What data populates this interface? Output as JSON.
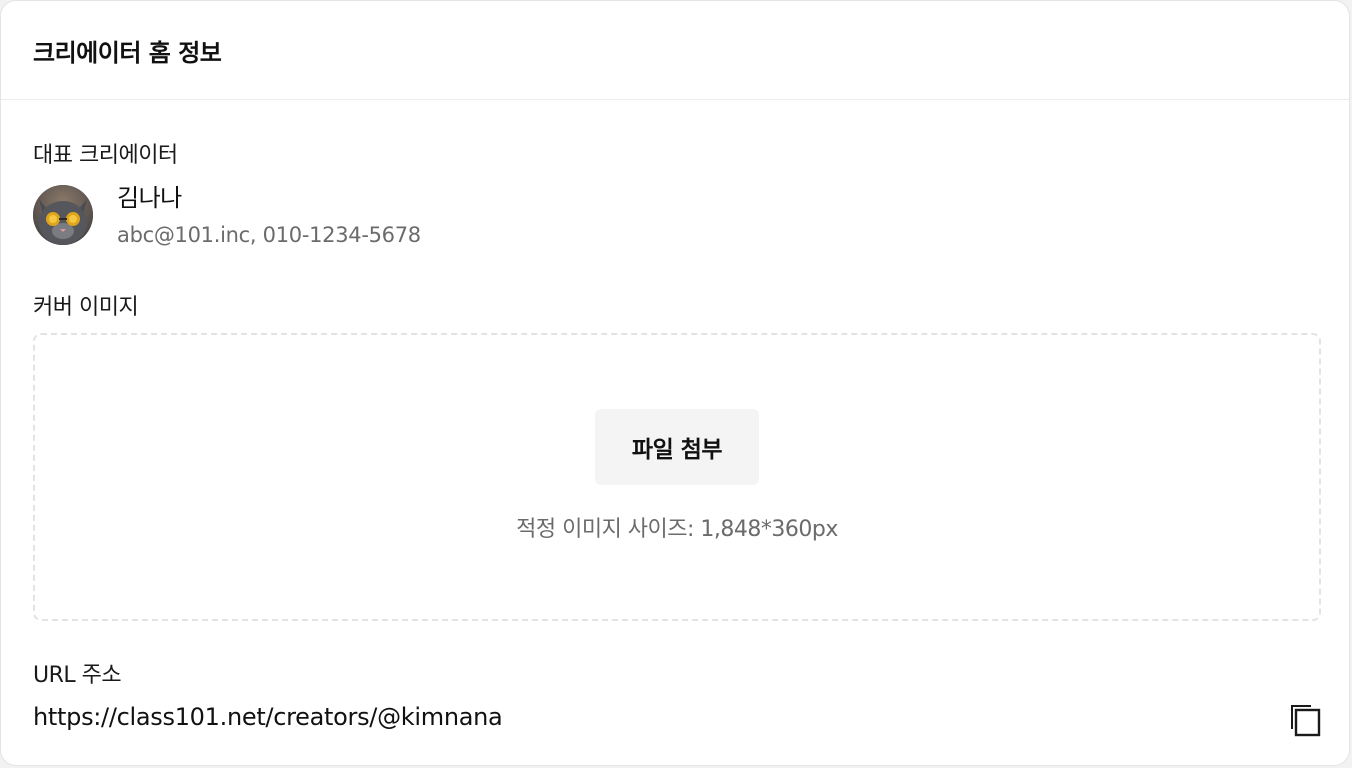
{
  "header": {
    "title": "크리에이터 홈 정보"
  },
  "creator": {
    "label": "대표 크리에이터",
    "name": "김나나",
    "contact": "abc@101.inc, 010-1234-5678",
    "avatar_icon": "cat-with-sunglasses-avatar"
  },
  "cover": {
    "label": "커버 이미지",
    "attach_label": "파일 첨부",
    "size_hint": "적정 이미지 사이즈: 1,848*360px"
  },
  "url": {
    "label": "URL 주소",
    "value": "https://class101.net/creators/@kimnana",
    "copy_icon": "copy-icon"
  },
  "colors": {
    "card_background": "#ffffff",
    "secondary_text": "#6b6b6b",
    "button_background": "#f4f4f4",
    "dashed_border": "#e3e3e3"
  }
}
